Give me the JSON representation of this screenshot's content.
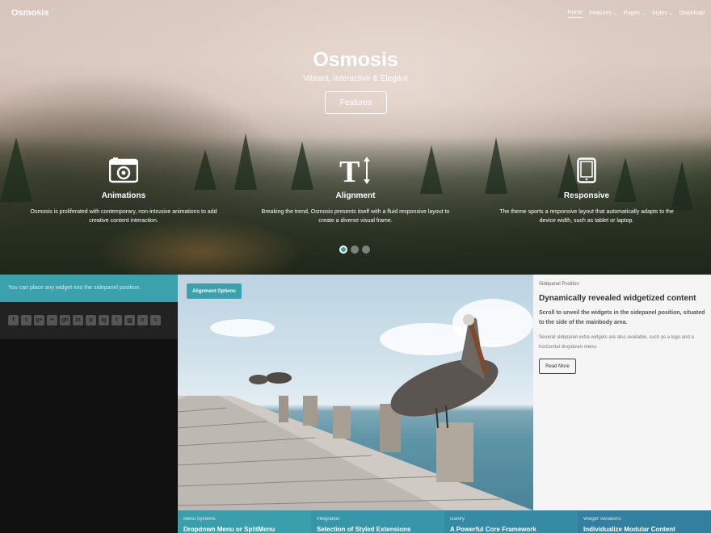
{
  "header": {
    "logo": "Osmosis",
    "nav": [
      {
        "label": "Home",
        "active": true,
        "dropdown": false
      },
      {
        "label": "Features",
        "active": false,
        "dropdown": true
      },
      {
        "label": "Pages",
        "active": false,
        "dropdown": true
      },
      {
        "label": "Styles",
        "active": false,
        "dropdown": true
      },
      {
        "label": "Download",
        "active": false,
        "dropdown": false
      }
    ]
  },
  "hero": {
    "title": "Osmosis",
    "subtitle": "Vibrant, Interactive & Elegant",
    "button": "Features",
    "features": [
      {
        "icon": "camera-icon",
        "title": "Animations",
        "desc": "Osmosis is proliferated with contemporary, non-intrusive animations to add creative content interaction."
      },
      {
        "icon": "text-height-icon",
        "title": "Alignment",
        "desc": "Breaking the trend, Osmosis presents itself with a fluid responsive layout to create a diverse visual frame."
      },
      {
        "icon": "tablet-icon",
        "title": "Responsive",
        "desc": "The theme sports a responsive layout that automatically adapts to the device width, such as tablet or laptop."
      }
    ],
    "slides_active": 1,
    "slides_total": 3
  },
  "sidepanel": {
    "text": "You can place any widget into the sidepanel position.",
    "social": [
      "facebook-icon",
      "twitter-icon",
      "google-plus-icon",
      "flickr-icon",
      "github-icon",
      "linkedin-icon",
      "pinterest-icon",
      "instagram-icon",
      "tumblr-icon",
      "trello-icon",
      "xing-icon",
      "skype-icon"
    ],
    "social_glyphs": [
      "f",
      "t",
      "g+",
      "••",
      "gh",
      "in",
      "p",
      "ig",
      "t",
      "▥",
      "x",
      "s"
    ]
  },
  "main": {
    "button": "Alignment Options"
  },
  "right_panel": {
    "label": "Sidepanel Position",
    "title": "Dynamically revealed widgetized content",
    "lead": "Scroll to unveil the widgets in the sidepanel position, situated to the side of the mainbody area.",
    "text": "Several sidepanel extra widgets are also available, such as a logo and a horizontal dropdown menu.",
    "button": "Read More"
  },
  "strip": [
    {
      "label": "Menu Systems",
      "title": "Dropdown Menu or SplitMenu",
      "color": "#3a9fab"
    },
    {
      "label": "Integration",
      "title": "Selection of Styled Extensions",
      "color": "#3796a8"
    },
    {
      "label": "Gantry",
      "title": "A Powerful Core Framework",
      "color": "#358aa4"
    },
    {
      "label": "Widget Variations",
      "title": "Individualize Modular Content",
      "color": "#337fa0"
    }
  ],
  "colors": {
    "accent": "#3aa1ad",
    "dark": "#111111"
  }
}
